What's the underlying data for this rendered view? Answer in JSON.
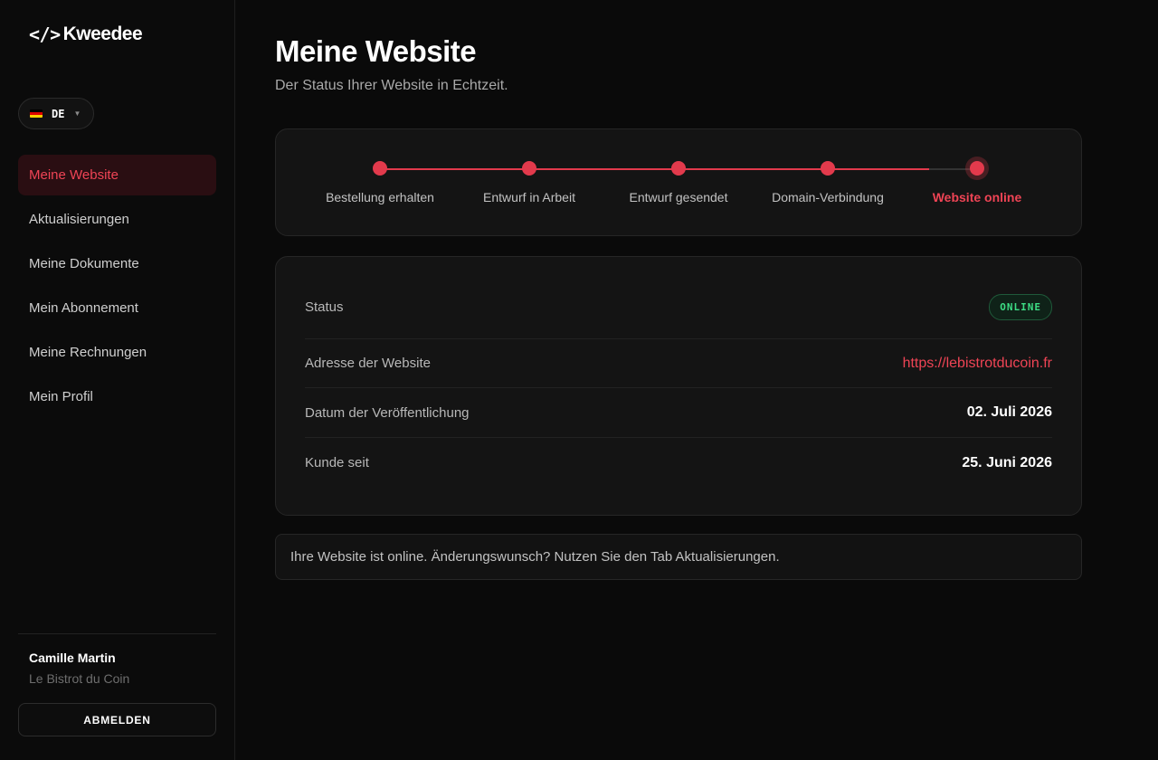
{
  "brand": {
    "code_mark": "</>",
    "name": "Kweedee"
  },
  "language": {
    "code": "DE",
    "flag_colors": [
      "#000000",
      "#dd0000",
      "#ffce00"
    ]
  },
  "sidebar": {
    "items": [
      {
        "label": "Meine Website",
        "active": true
      },
      {
        "label": "Aktualisierungen",
        "active": false
      },
      {
        "label": "Meine Dokumente",
        "active": false
      },
      {
        "label": "Mein Abonnement",
        "active": false
      },
      {
        "label": "Meine Rechnungen",
        "active": false
      },
      {
        "label": "Mein Profil",
        "active": false
      }
    ],
    "user": {
      "name": "Camille Martin",
      "company": "Le Bistrot du Coin"
    },
    "logout_label": "ABMELDEN"
  },
  "header": {
    "title": "Meine Website",
    "subtitle": "Der Status Ihrer Website in Echtzeit."
  },
  "progress": {
    "completed_fraction": 0.92,
    "current_step_index": 4,
    "steps": [
      {
        "label": "Bestellung erhalten"
      },
      {
        "label": "Entwurf in Arbeit"
      },
      {
        "label": "Entwurf gesendet"
      },
      {
        "label": "Domain-Verbindung"
      },
      {
        "label": "Website online"
      }
    ]
  },
  "details": {
    "status_label": "Status",
    "status_value": "ONLINE",
    "address_label": "Adresse der Website",
    "address_value": "https://lebistrotducoin.fr",
    "published_label": "Datum der Veröffentlichung",
    "published_value": "02. Juli 2026",
    "customer_since_label": "Kunde seit",
    "customer_since_value": "25. Juni 2026"
  },
  "notice": "Ihre Website ist online. Änderungswunsch? Nutzen Sie den Tab Aktualisierungen.",
  "colors": {
    "accent": "#e23a4c",
    "accent_text": "#ef4455",
    "online_green": "#3ddc84",
    "background": "#0a0a0a"
  }
}
